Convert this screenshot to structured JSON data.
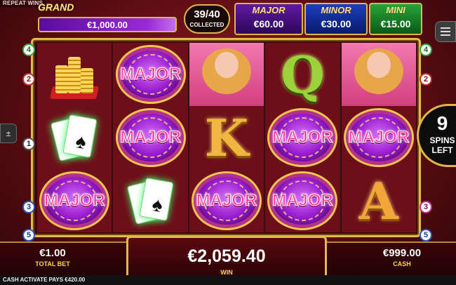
{
  "top": {
    "repeat_wins": "REPEAT WINS",
    "grand_label": "GRAND",
    "grand_value": "€1,000.00",
    "collected_count": "39/40",
    "collected_label": "COLLECTED",
    "major_label": "MAJOR",
    "major_value": "€60.00",
    "minor_label": "MINOR",
    "minor_value": "€30.00",
    "mini_label": "MINI",
    "mini_value": "€15.00"
  },
  "reels": [
    [
      {
        "type": "coins"
      },
      {
        "type": "cards"
      },
      {
        "type": "chip",
        "text": "MAJOR"
      }
    ],
    [
      {
        "type": "chip",
        "text": "MAJOR"
      },
      {
        "type": "chip",
        "text": "MAJOR"
      },
      {
        "type": "cards"
      }
    ],
    [
      {
        "type": "woman"
      },
      {
        "type": "letter",
        "text": "K"
      },
      {
        "type": "chip",
        "text": "MAJOR"
      }
    ],
    [
      {
        "type": "letter",
        "text": "Q"
      },
      {
        "type": "chip",
        "text": "MAJOR"
      },
      {
        "type": "chip",
        "text": "MAJOR"
      }
    ],
    [
      {
        "type": "woman"
      },
      {
        "type": "chip",
        "text": "MAJOR"
      },
      {
        "type": "letter",
        "text": "A"
      }
    ]
  ],
  "paylines_left": [
    "4",
    "2",
    "1",
    "3",
    "5"
  ],
  "paylines_right": [
    "4",
    "2",
    "3",
    "5"
  ],
  "spins_left": {
    "count": "9",
    "label_1": "SPINS",
    "label_2": "LEFT"
  },
  "left_tab_icon": "sound-toggle-icon",
  "bottom": {
    "total_bet_value": "€1.00",
    "total_bet_label": "TOTAL BET",
    "win_value": "€2,059.40",
    "win_label": "WIN",
    "cash_value": "€999.00",
    "cash_label": "CASH"
  },
  "ticker": "CASH ACTIVATE PAYS €420.00",
  "colors": {
    "gold": "#e5b84a",
    "major": "#5f1aa3",
    "minor": "#1a3fc0",
    "mini": "#27a33a"
  }
}
